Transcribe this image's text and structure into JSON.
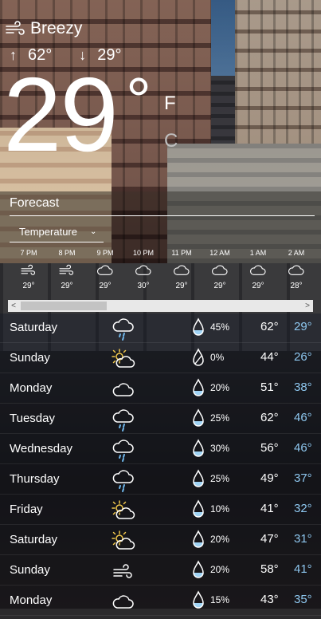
{
  "current": {
    "condition": "Breezy",
    "condition_icon": "wind-icon",
    "high": "62°",
    "low": "29°",
    "temp": "29",
    "degree": "°",
    "unit_f": "F",
    "unit_c": "C"
  },
  "forecast": {
    "title": "Forecast",
    "dropdown": "Temperature",
    "hourly": [
      {
        "time": "7 PM",
        "icon": "wind-icon",
        "temp": "29°"
      },
      {
        "time": "8 PM",
        "icon": "wind-icon",
        "temp": "29°"
      },
      {
        "time": "9 PM",
        "icon": "cloud-icon",
        "temp": "29°"
      },
      {
        "time": "10 PM",
        "icon": "cloud-icon",
        "temp": "30°"
      },
      {
        "time": "11 PM",
        "icon": "cloud-icon",
        "temp": "29°"
      },
      {
        "time": "12 AM",
        "icon": "cloud-icon",
        "temp": "29°"
      },
      {
        "time": "1 AM",
        "icon": "cloud-icon",
        "temp": "29°"
      },
      {
        "time": "2 AM",
        "icon": "cloud-icon",
        "temp": "28°"
      }
    ],
    "daily": [
      {
        "day": "Saturday",
        "icon": "rain-cloud-icon",
        "precip": "45%",
        "high": "62°",
        "low": "29°"
      },
      {
        "day": "Sunday",
        "icon": "partly-sunny-icon",
        "precip": "0%",
        "high": "44°",
        "low": "26°"
      },
      {
        "day": "Monday",
        "icon": "cloud-icon",
        "precip": "20%",
        "high": "51°",
        "low": "38°"
      },
      {
        "day": "Tuesday",
        "icon": "rain-cloud-icon",
        "precip": "25%",
        "high": "62°",
        "low": "46°"
      },
      {
        "day": "Wednesday",
        "icon": "rain-cloud-icon",
        "precip": "30%",
        "high": "56°",
        "low": "46°"
      },
      {
        "day": "Thursday",
        "icon": "rain-cloud-icon",
        "precip": "25%",
        "high": "49°",
        "low": "37°"
      },
      {
        "day": "Friday",
        "icon": "partly-sunny-icon",
        "precip": "10%",
        "high": "41°",
        "low": "32°"
      },
      {
        "day": "Saturday",
        "icon": "partly-sunny-icon",
        "precip": "20%",
        "high": "47°",
        "low": "31°"
      },
      {
        "day": "Sunday",
        "icon": "wind-icon",
        "precip": "20%",
        "high": "58°",
        "low": "41°"
      },
      {
        "day": "Monday",
        "icon": "cloud-icon",
        "precip": "15%",
        "high": "43°",
        "low": "35°"
      }
    ]
  },
  "colors": {
    "low_temp": "#8ec7ef",
    "sun": "#f2c94c"
  }
}
